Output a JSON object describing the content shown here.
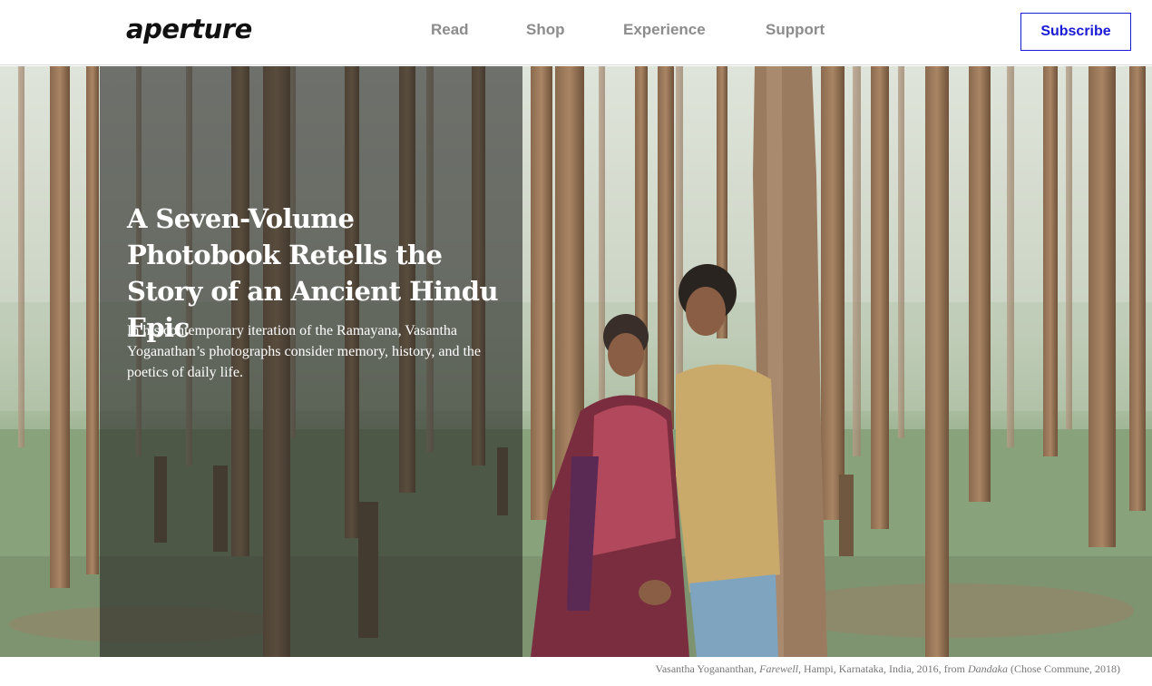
{
  "header": {
    "logo": "aperture",
    "nav": [
      {
        "label": "Read"
      },
      {
        "label": "Shop"
      },
      {
        "label": "Experience"
      },
      {
        "label": "Support"
      }
    ],
    "subscribe_label": "Subscribe"
  },
  "hero": {
    "title": "A Seven-Volume Photobook Retells the Story of an Ancient Hindu Epic",
    "dek": "In his contemporary iteration of the Ramayana, Vasantha Yoganathan’s photographs consider memory, history, and the poetics of daily life."
  },
  "caption": {
    "artist": "Vasantha Yogananthan, ",
    "work": "Farewell",
    "details": ", Hampi, Karnataka, India, 2016, from ",
    "book": "Dandaka",
    "publisher": " (Chose Commune, 2018)"
  },
  "colors": {
    "accent": "#1a1ad6",
    "nav_text": "#8c8c8c",
    "overlay": "#282a26"
  }
}
